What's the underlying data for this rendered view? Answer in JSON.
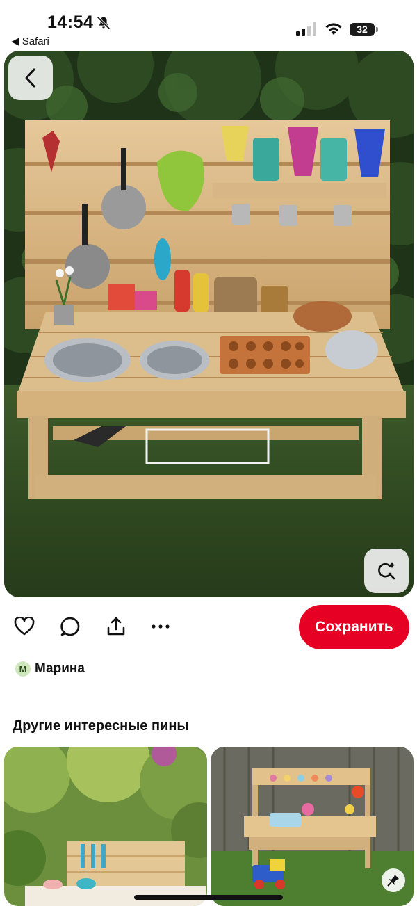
{
  "status_bar": {
    "time": "14:54",
    "back_app_label": "◀ Safari",
    "battery_level": "32",
    "icons": [
      "bell-slash-icon",
      "signal-icon",
      "wifi-icon",
      "battery-icon"
    ]
  },
  "hero": {
    "back_button_icon": "chevron-left-icon",
    "visual_search_icon": "visual-search-icon"
  },
  "actions": {
    "icons": [
      "heart-icon",
      "comment-icon",
      "share-icon",
      "more-icon"
    ],
    "save_label": "Сохранить"
  },
  "author": {
    "initial": "М",
    "name": "Марина"
  },
  "more_section": {
    "title": "Другие интересные пины"
  },
  "colors": {
    "save_button": "#e60023",
    "avatar_bg": "#cfe7bd"
  }
}
